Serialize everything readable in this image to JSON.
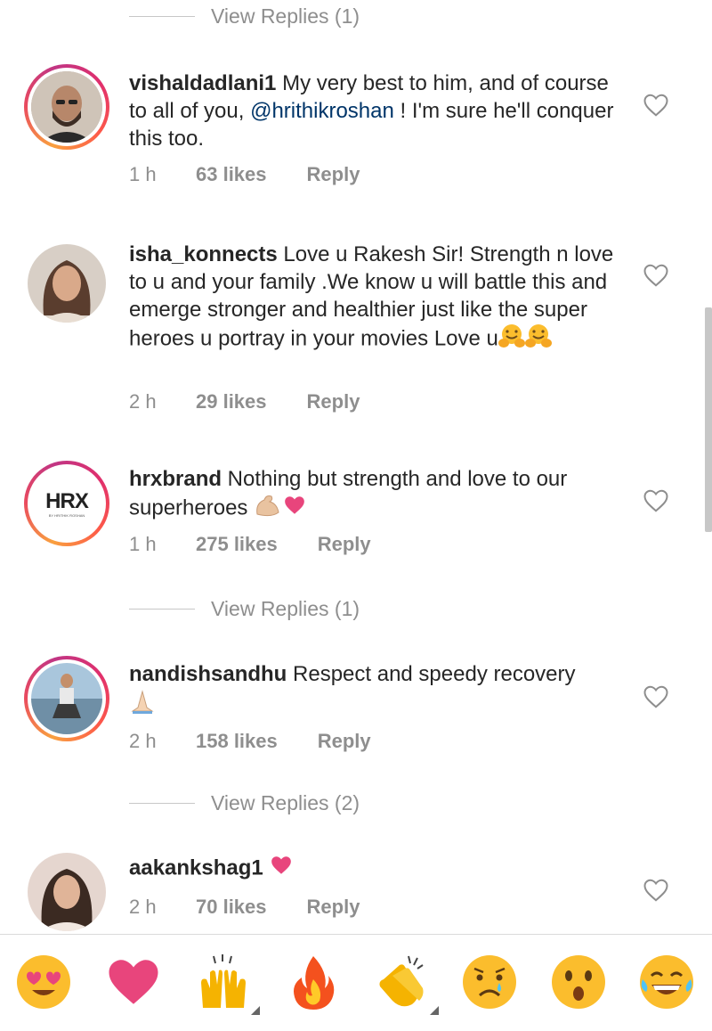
{
  "view_replies_top": "View Replies (1)",
  "comments": [
    {
      "username": "vishaldadlani1",
      "text_before": " My very best to him, and of course to all of you, ",
      "mention": "@hrithikroshan",
      "text_after": " ! I'm sure he'll conquer this too.",
      "time": "1 h",
      "likes": "63 likes",
      "reply": "Reply",
      "avatar_icon": "person-bald-beard-avatar"
    },
    {
      "username": "isha_konnects",
      "text": " Love u Rakesh Sir! Strength n love to u and your family .We know u will battle this and emerge stronger and healthier just like the super heroes u portray in your movies  Love u",
      "emoji": [
        "hugging-face-icon",
        "hugging-face-icon"
      ],
      "time": "2 h",
      "likes": "29 likes",
      "reply": "Reply",
      "avatar_icon": "woman-portrait-avatar"
    },
    {
      "username": "hrxbrand",
      "text": " Nothing but strength and love to our superheroes ",
      "emoji": [
        "flexed-biceps-icon",
        "heart-icon"
      ],
      "time": "1 h",
      "likes": "275 likes",
      "reply": "Reply",
      "avatar_logo": "HRX",
      "avatar_sub": "BY HRITHIK ROSHAN"
    },
    {
      "username": "nandishsandhu",
      "text": " Respect and speedy recovery",
      "emoji": [
        "folded-hands-icon"
      ],
      "time": "2 h",
      "likes": "158 likes",
      "reply": "Reply",
      "avatar_icon": "man-sitting-beach-avatar"
    },
    {
      "username": "aakankshag1",
      "text": " ",
      "emoji": [
        "heart-icon"
      ],
      "time": "2 h",
      "likes": "70 likes",
      "reply": "Reply",
      "avatar_icon": "woman-portrait-avatar"
    }
  ],
  "view_replies": [
    "View Replies (1)",
    "View Replies (2)"
  ],
  "emoji_bar": [
    "smiling-face-heart-eyes-icon",
    "heart-icon",
    "raising-hands-icon",
    "fire-icon",
    "clapping-hands-icon",
    "crying-face-icon",
    "astonished-face-icon",
    "face-with-tears-of-joy-icon"
  ],
  "colors": {
    "text": "#262626",
    "muted": "#8e8e8e",
    "mention": "#003569",
    "heart": "#e8457c"
  }
}
